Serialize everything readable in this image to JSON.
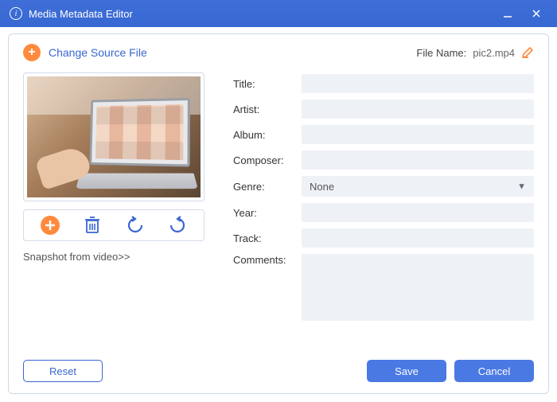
{
  "window": {
    "title": "Media Metadata Editor"
  },
  "header": {
    "change_source_label": "Change Source File",
    "file_name_label": "File Name:",
    "file_name_value": "pic2.mp4"
  },
  "snapshot_link": "Snapshot from video>>",
  "fields": {
    "title_label": "Title:",
    "title_value": "",
    "artist_label": "Artist:",
    "artist_value": "",
    "album_label": "Album:",
    "album_value": "",
    "composer_label": "Composer:",
    "composer_value": "",
    "genre_label": "Genre:",
    "genre_value": "None",
    "year_label": "Year:",
    "year_value": "",
    "track_label": "Track:",
    "track_value": "",
    "comments_label": "Comments:",
    "comments_value": ""
  },
  "buttons": {
    "reset": "Reset",
    "save": "Save",
    "cancel": "Cancel"
  },
  "colors": {
    "accent": "#3a66d1",
    "orange": "#ff8a3d",
    "field_bg": "#eef1f6"
  }
}
